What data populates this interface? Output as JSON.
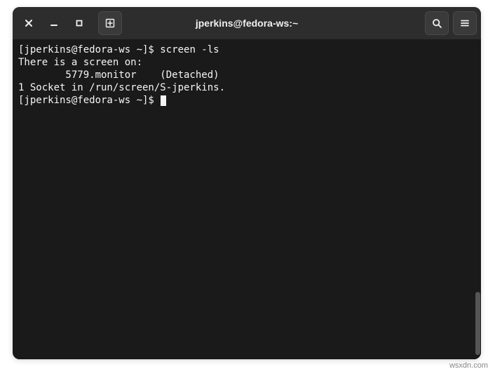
{
  "window": {
    "title": "jperkins@fedora-ws:~"
  },
  "terminal": {
    "lines": [
      {
        "prompt": "[jperkins@fedora-ws ~]$ ",
        "command": "screen -ls"
      },
      {
        "text": "There is a screen on:"
      },
      {
        "text": "        5779.monitor    (Detached)"
      },
      {
        "text": "1 Socket in /run/screen/S-jperkins."
      },
      {
        "prompt": "[jperkins@fedora-ws ~]$ ",
        "command": "",
        "cursor": true
      }
    ]
  },
  "watermark": "wsxdn.com"
}
